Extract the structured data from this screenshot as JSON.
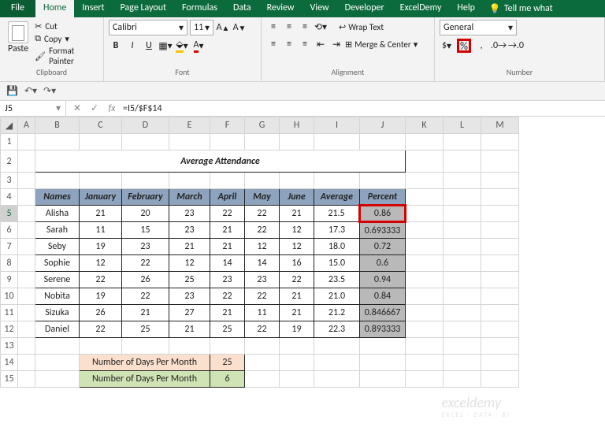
{
  "tabs": {
    "file": "File",
    "home": "Home",
    "insert": "Insert",
    "pagelayout": "Page Layout",
    "formulas": "Formulas",
    "data": "Data",
    "review": "Review",
    "view": "View",
    "developer": "Developer",
    "exceldemy": "ExcelDemy",
    "help": "Help",
    "tell": "Tell me what"
  },
  "clipboard": {
    "paste": "Paste",
    "cut": "Cut",
    "copy": "Copy",
    "fmt": "Format Painter",
    "label": "Clipboard"
  },
  "font": {
    "name": "Calibri",
    "size": "11",
    "label": "Font"
  },
  "align": {
    "wrap": "Wrap Text",
    "merge": "Merge & Center",
    "label": "Alignment"
  },
  "number": {
    "fmt": "General",
    "label": "Number",
    "dollar": "$",
    "pct": "%",
    "comma": ","
  },
  "ref": {
    "cell": "J5",
    "formula": "=I5/$F$14"
  },
  "cols": [
    "",
    "A",
    "B",
    "C",
    "D",
    "E",
    "F",
    "G",
    "H",
    "I",
    "J",
    "K",
    "L",
    "M"
  ],
  "title": "Average Attendance",
  "headers": {
    "names": "Names",
    "jan": "January",
    "feb": "February",
    "mar": "March",
    "apr": "April",
    "may": "May",
    "jun": "June",
    "avg": "Average",
    "pct": "Percent"
  },
  "rows": [
    {
      "n": "Alisha",
      "j": "21",
      "f": "20",
      "m": "23",
      "a": "22",
      "ma": "22",
      "ju": "21",
      "av": "21.5",
      "p": "0.86"
    },
    {
      "n": "Sarah",
      "j": "11",
      "f": "15",
      "m": "23",
      "a": "21",
      "ma": "22",
      "ju": "12",
      "av": "17.3",
      "p": "0.693333"
    },
    {
      "n": "Seby",
      "j": "19",
      "f": "23",
      "m": "21",
      "a": "21",
      "ma": "12",
      "ju": "12",
      "av": "18.0",
      "p": "0.72"
    },
    {
      "n": "Sophie",
      "j": "12",
      "f": "22",
      "m": "12",
      "a": "14",
      "ma": "14",
      "ju": "16",
      "av": "15.0",
      "p": "0.6"
    },
    {
      "n": "Serene",
      "j": "22",
      "f": "26",
      "m": "25",
      "a": "23",
      "ma": "23",
      "ju": "22",
      "av": "23.5",
      "p": "0.94"
    },
    {
      "n": "Nobita",
      "j": "19",
      "f": "22",
      "m": "23",
      "a": "22",
      "ma": "22",
      "ju": "21",
      "av": "21.0",
      "p": "0.84"
    },
    {
      "n": "Sizuka",
      "j": "26",
      "f": "21",
      "m": "27",
      "a": "21",
      "ma": "11",
      "ju": "21",
      "av": "21.2",
      "p": "0.846667"
    },
    {
      "n": "Daniel",
      "j": "22",
      "f": "25",
      "m": "21",
      "a": "25",
      "ma": "22",
      "ju": "19",
      "av": "22.3",
      "p": "0.893333"
    }
  ],
  "days": {
    "label1": "Number of Days Per Month",
    "val1": "25",
    "label2": "Number of Days Per Month",
    "val2": "6"
  },
  "wm": {
    "main": "exceldemy",
    "sub": "EXCEL · DATA · BI"
  }
}
